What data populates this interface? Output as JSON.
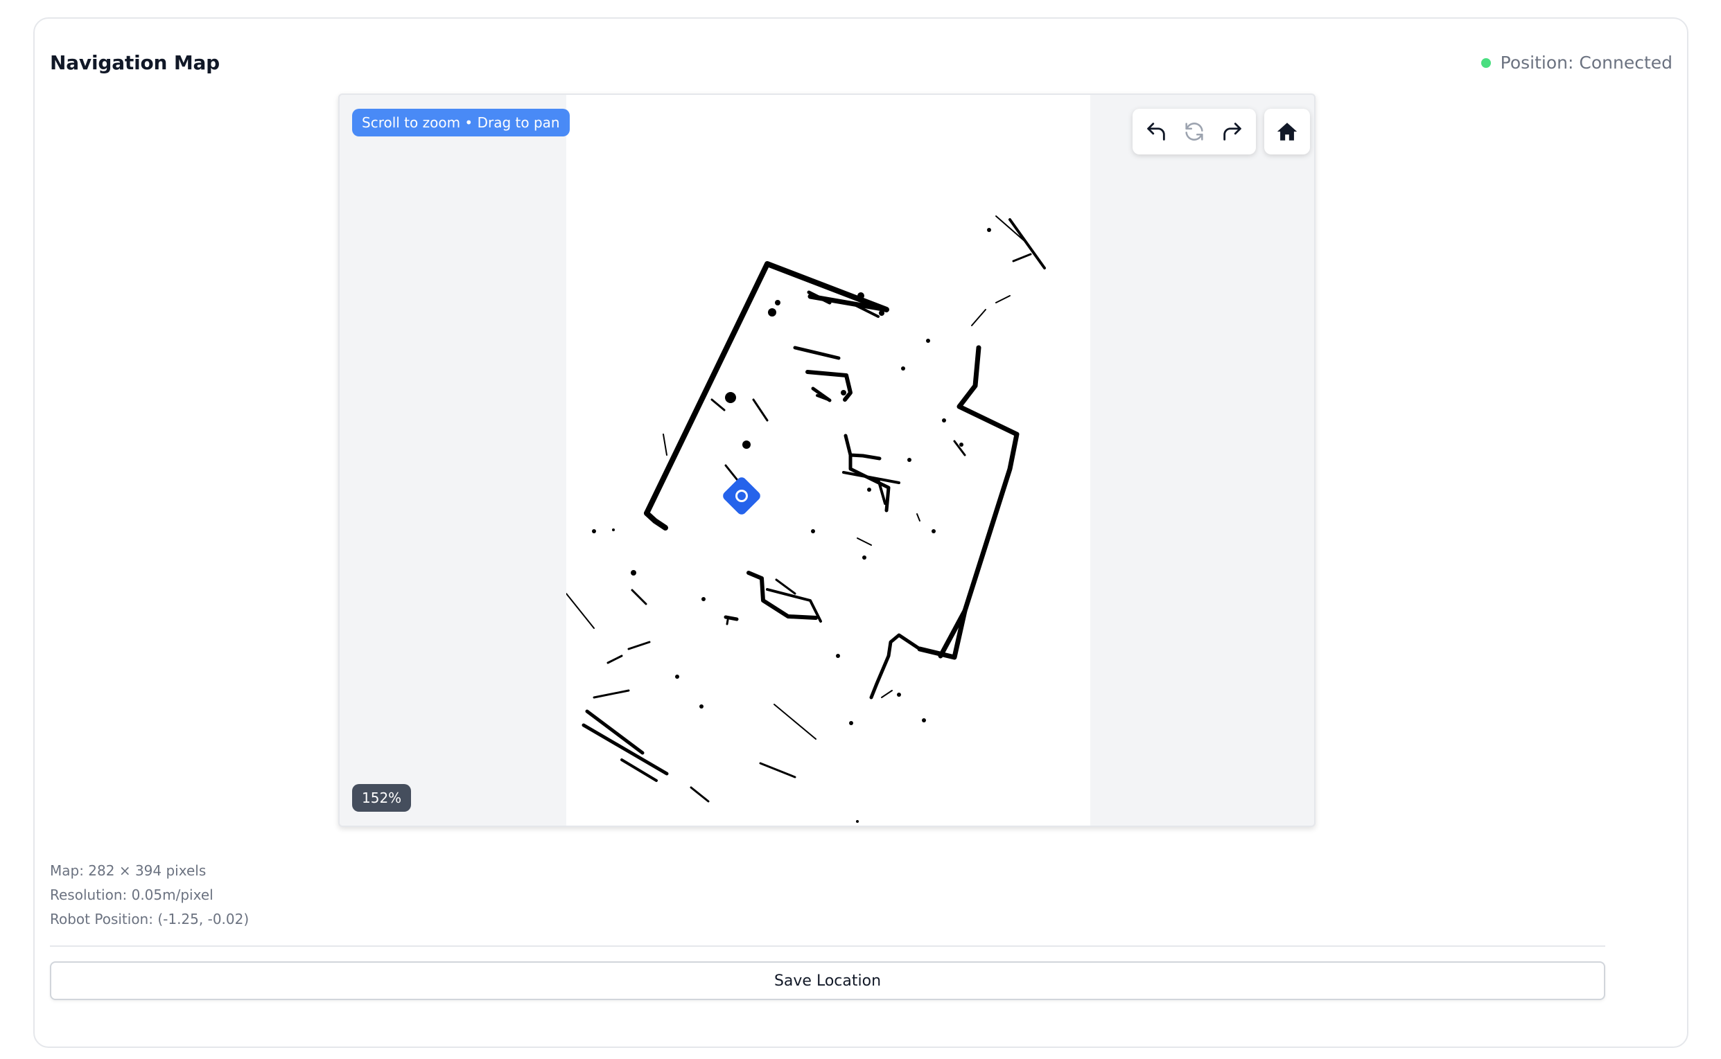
{
  "header": {
    "title": "Navigation Map",
    "status_text": "Position: Connected",
    "status_color": "#4ade80"
  },
  "map": {
    "hint": "Scroll to zoom • Drag to pan",
    "zoom_label": "152%",
    "toolbar": {
      "undo_icon": "undo-icon",
      "reset_icon": "reset-rotation-icon",
      "redo_icon": "redo-icon",
      "home_icon": "home-icon"
    },
    "robot_marker_color": "#2563eb"
  },
  "info": {
    "map_size": "Map: 282 × 394 pixels",
    "resolution": "Resolution: 0.05m/pixel",
    "robot_position": "Robot Position: (-1.25, -0.02)"
  },
  "actions": {
    "save_label": "Save Location"
  }
}
